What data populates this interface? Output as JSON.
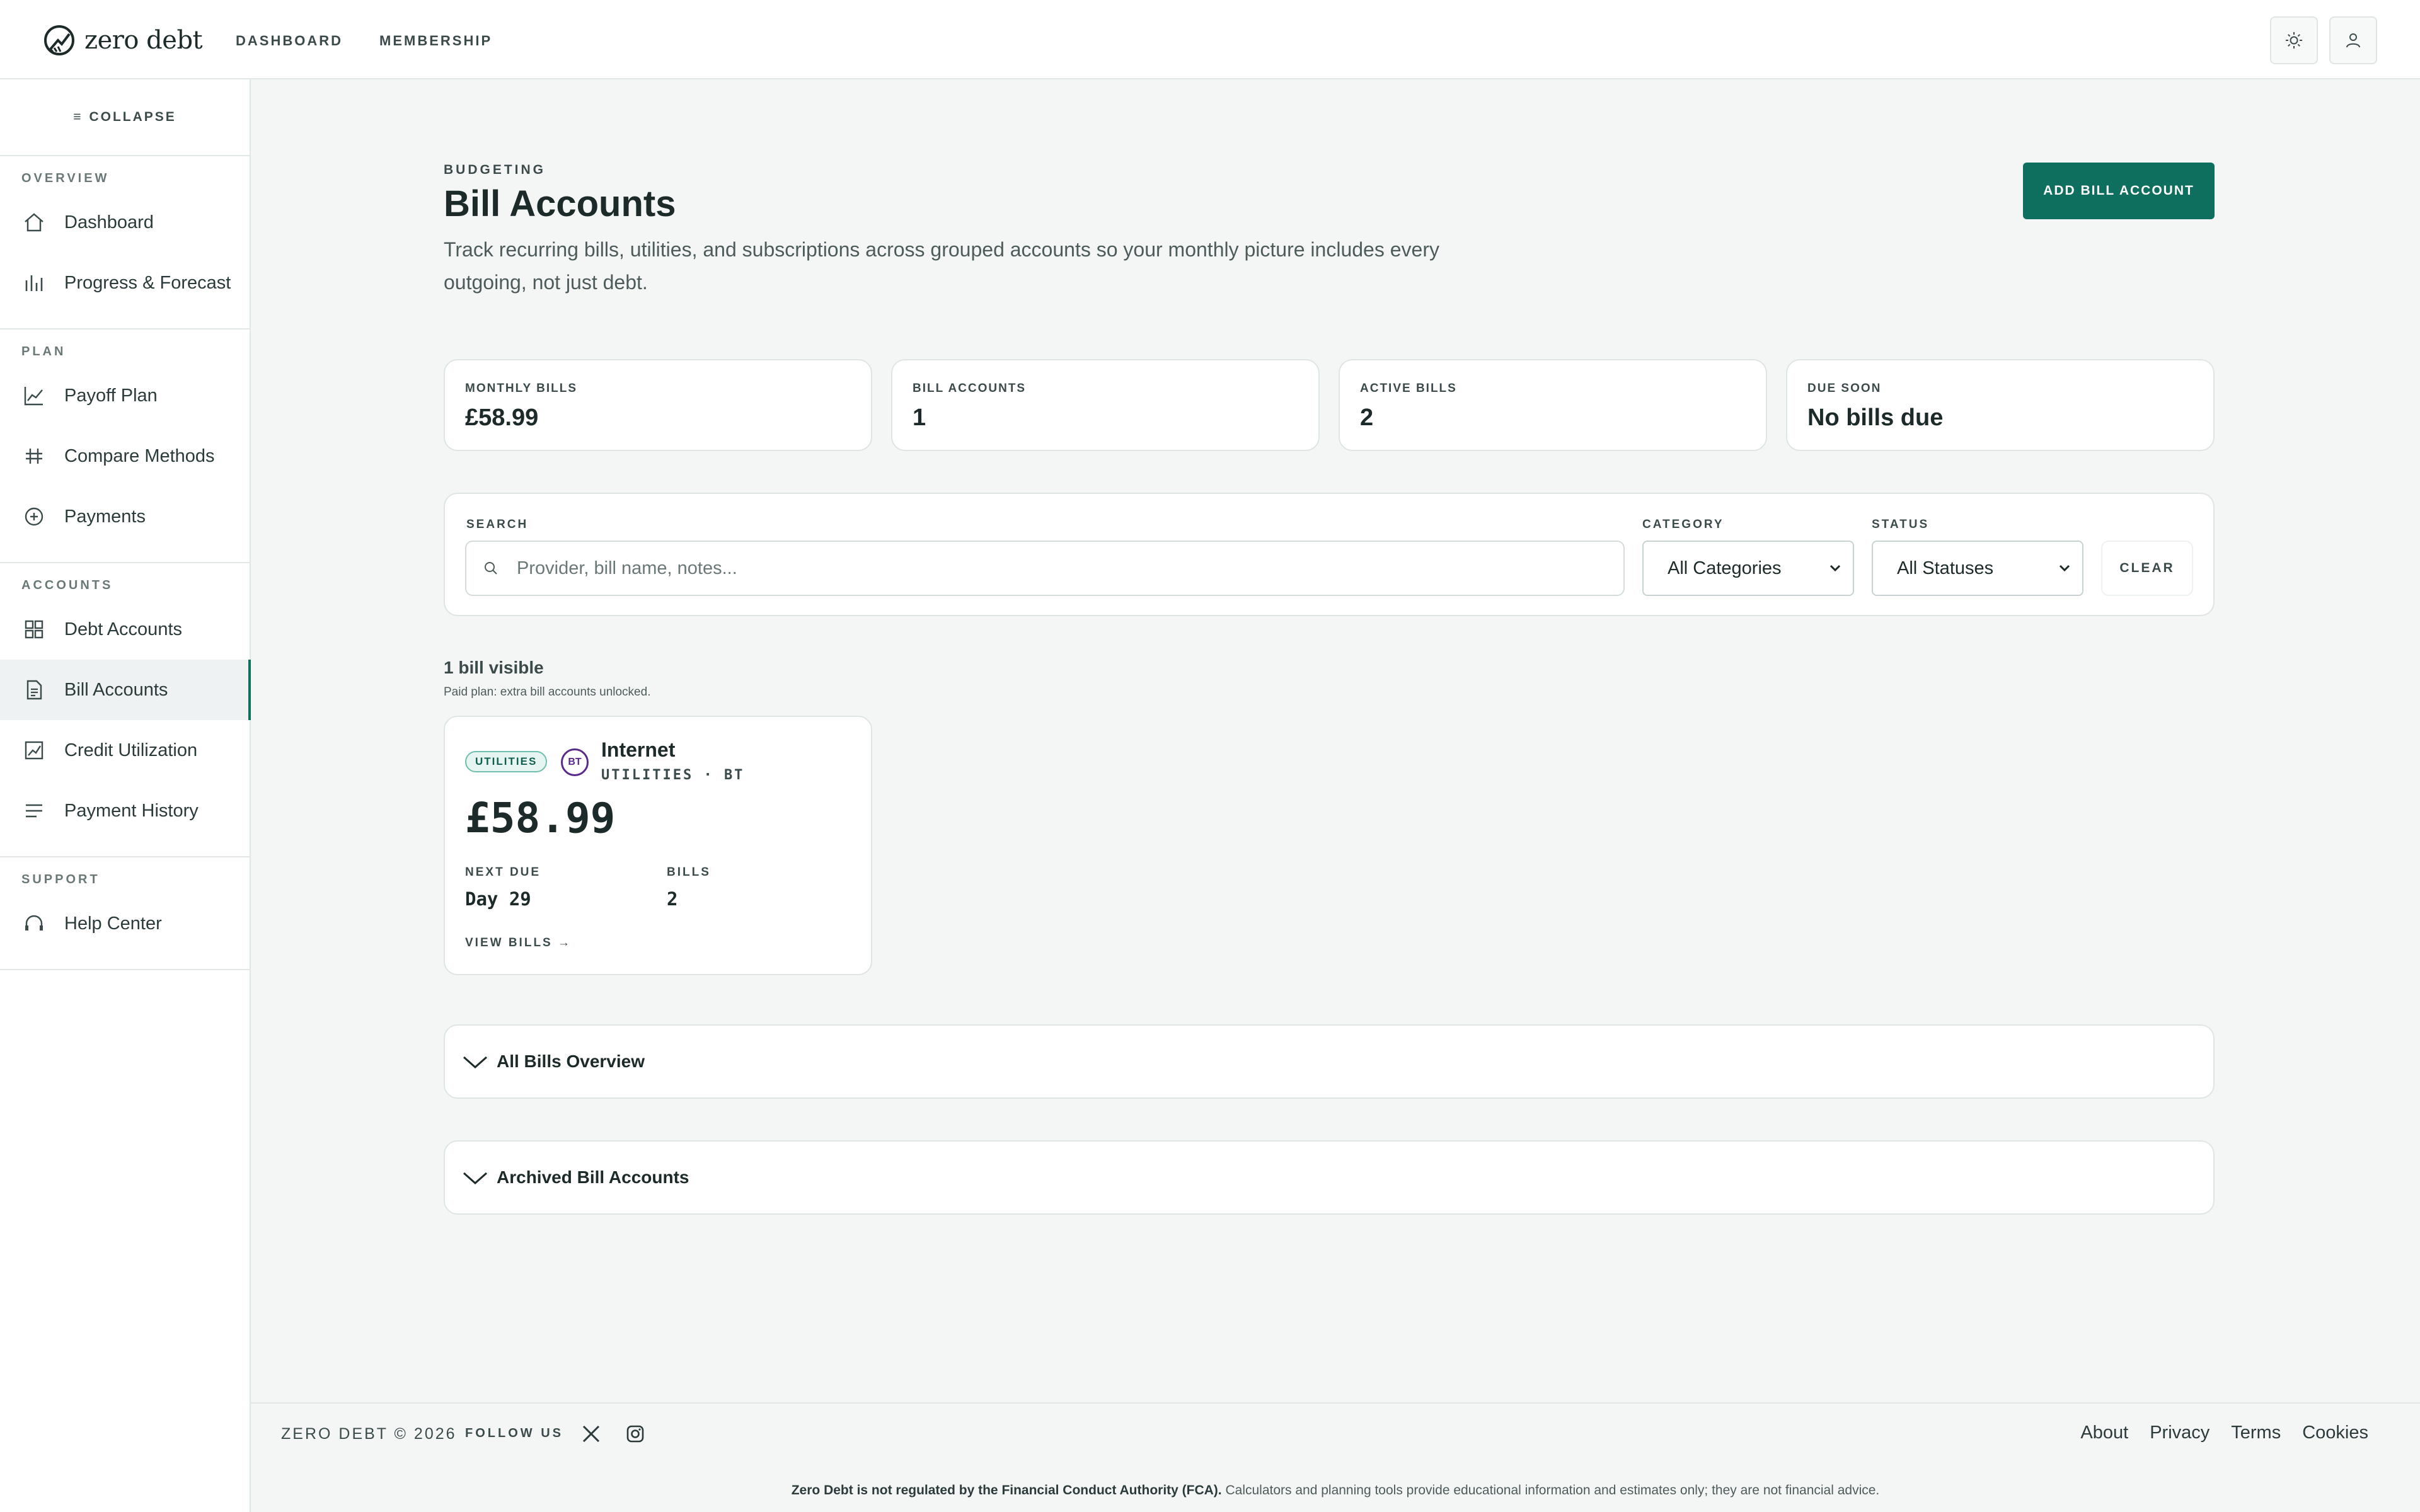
{
  "brand": {
    "name": "zero debt"
  },
  "topnav": {
    "items": [
      "DASHBOARD",
      "MEMBERSHIP"
    ]
  },
  "sidebar": {
    "collapse_label": "COLLAPSE",
    "groups": [
      {
        "label": "OVERVIEW",
        "items": [
          "Dashboard",
          "Progress & Forecast"
        ]
      },
      {
        "label": "PLAN",
        "items": [
          "Payoff Plan",
          "Compare Methods",
          "Payments"
        ]
      },
      {
        "label": "ACCOUNTS",
        "items": [
          "Debt Accounts",
          "Bill Accounts",
          "Credit Utilization",
          "Payment History"
        ]
      },
      {
        "label": "SUPPORT",
        "items": [
          "Help Center"
        ]
      }
    ],
    "active_item": "Bill Accounts"
  },
  "page": {
    "eyebrow": "BUDGETING",
    "title": "Bill Accounts",
    "description": "Track recurring bills, utilities, and subscriptions across grouped accounts so your monthly picture includes every outgoing, not just debt.",
    "add_button": "ADD BILL ACCOUNT"
  },
  "stats": [
    {
      "label": "MONTHLY BILLS",
      "value": "£58.99"
    },
    {
      "label": "BILL ACCOUNTS",
      "value": "1"
    },
    {
      "label": "ACTIVE BILLS",
      "value": "2"
    },
    {
      "label": "DUE SOON",
      "value": "No bills due"
    }
  ],
  "filters": {
    "search_label": "SEARCH",
    "search_placeholder": "Provider, bill name, notes...",
    "search_value": "",
    "category_label": "CATEGORY",
    "category_value": "All Categories",
    "status_label": "STATUS",
    "status_value": "All Statuses",
    "clear_label": "CLEAR"
  },
  "results": {
    "count_text": "1 bill visible",
    "plan_note": "Paid plan: extra bill accounts unlocked."
  },
  "bill_card": {
    "badge": "UTILITIES",
    "provider_logo": "BT",
    "name": "Internet",
    "subtitle": "UTILITIES · BT",
    "amount": "£58.99",
    "next_due_label": "NEXT DUE",
    "next_due_value": "Day 29",
    "bills_label": "BILLS",
    "bills_value": "2",
    "view_link": "VIEW BILLS →"
  },
  "sections": [
    {
      "title": "All Bills Overview"
    },
    {
      "title": "Archived Bill Accounts"
    }
  ],
  "footer": {
    "copyright": "ZERO DEBT © 2026",
    "follow_label": "FOLLOW US",
    "social_icons": [
      "x-icon",
      "instagram-icon"
    ],
    "links": [
      "About",
      "Privacy",
      "Terms",
      "Cookies"
    ],
    "disclaimer_bold": "Zero Debt is not regulated by the Financial Conduct Authority (FCA).",
    "disclaimer_rest": " Calculators and planning tools provide educational information and estimates only; they are not financial advice."
  },
  "colors": {
    "accent": "#0f6f5f",
    "background": "#f4f6f6"
  }
}
